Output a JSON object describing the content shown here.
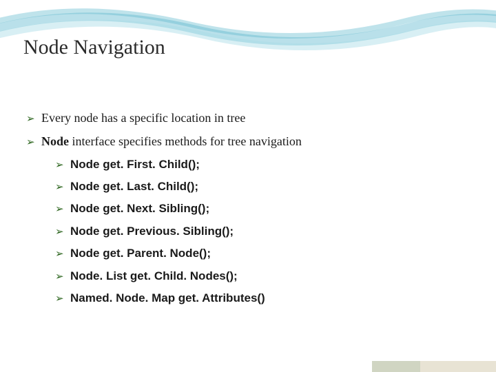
{
  "title": "Node Navigation",
  "bullets": {
    "b1_pre": "Every node has a specific location in tree",
    "b2_bold": "Node",
    "b2_rest": " interface specifies methods for tree navigation"
  },
  "sub": [
    {
      "type": "Node",
      "method": "get. First. Child();"
    },
    {
      "type": "Node",
      "method": "get. Last. Child();"
    },
    {
      "type": "Node",
      "method": "get. Next. Sibling();"
    },
    {
      "type": "Node",
      "method": "get. Previous. Sibling();"
    },
    {
      "type": "Node",
      "method": "get. Parent. Node();"
    },
    {
      "type": "Node. List",
      "method": "get. Child. Nodes();"
    },
    {
      "type": "Named. Node. Map",
      "method": "get. Attributes()"
    }
  ],
  "arrow": "➢"
}
